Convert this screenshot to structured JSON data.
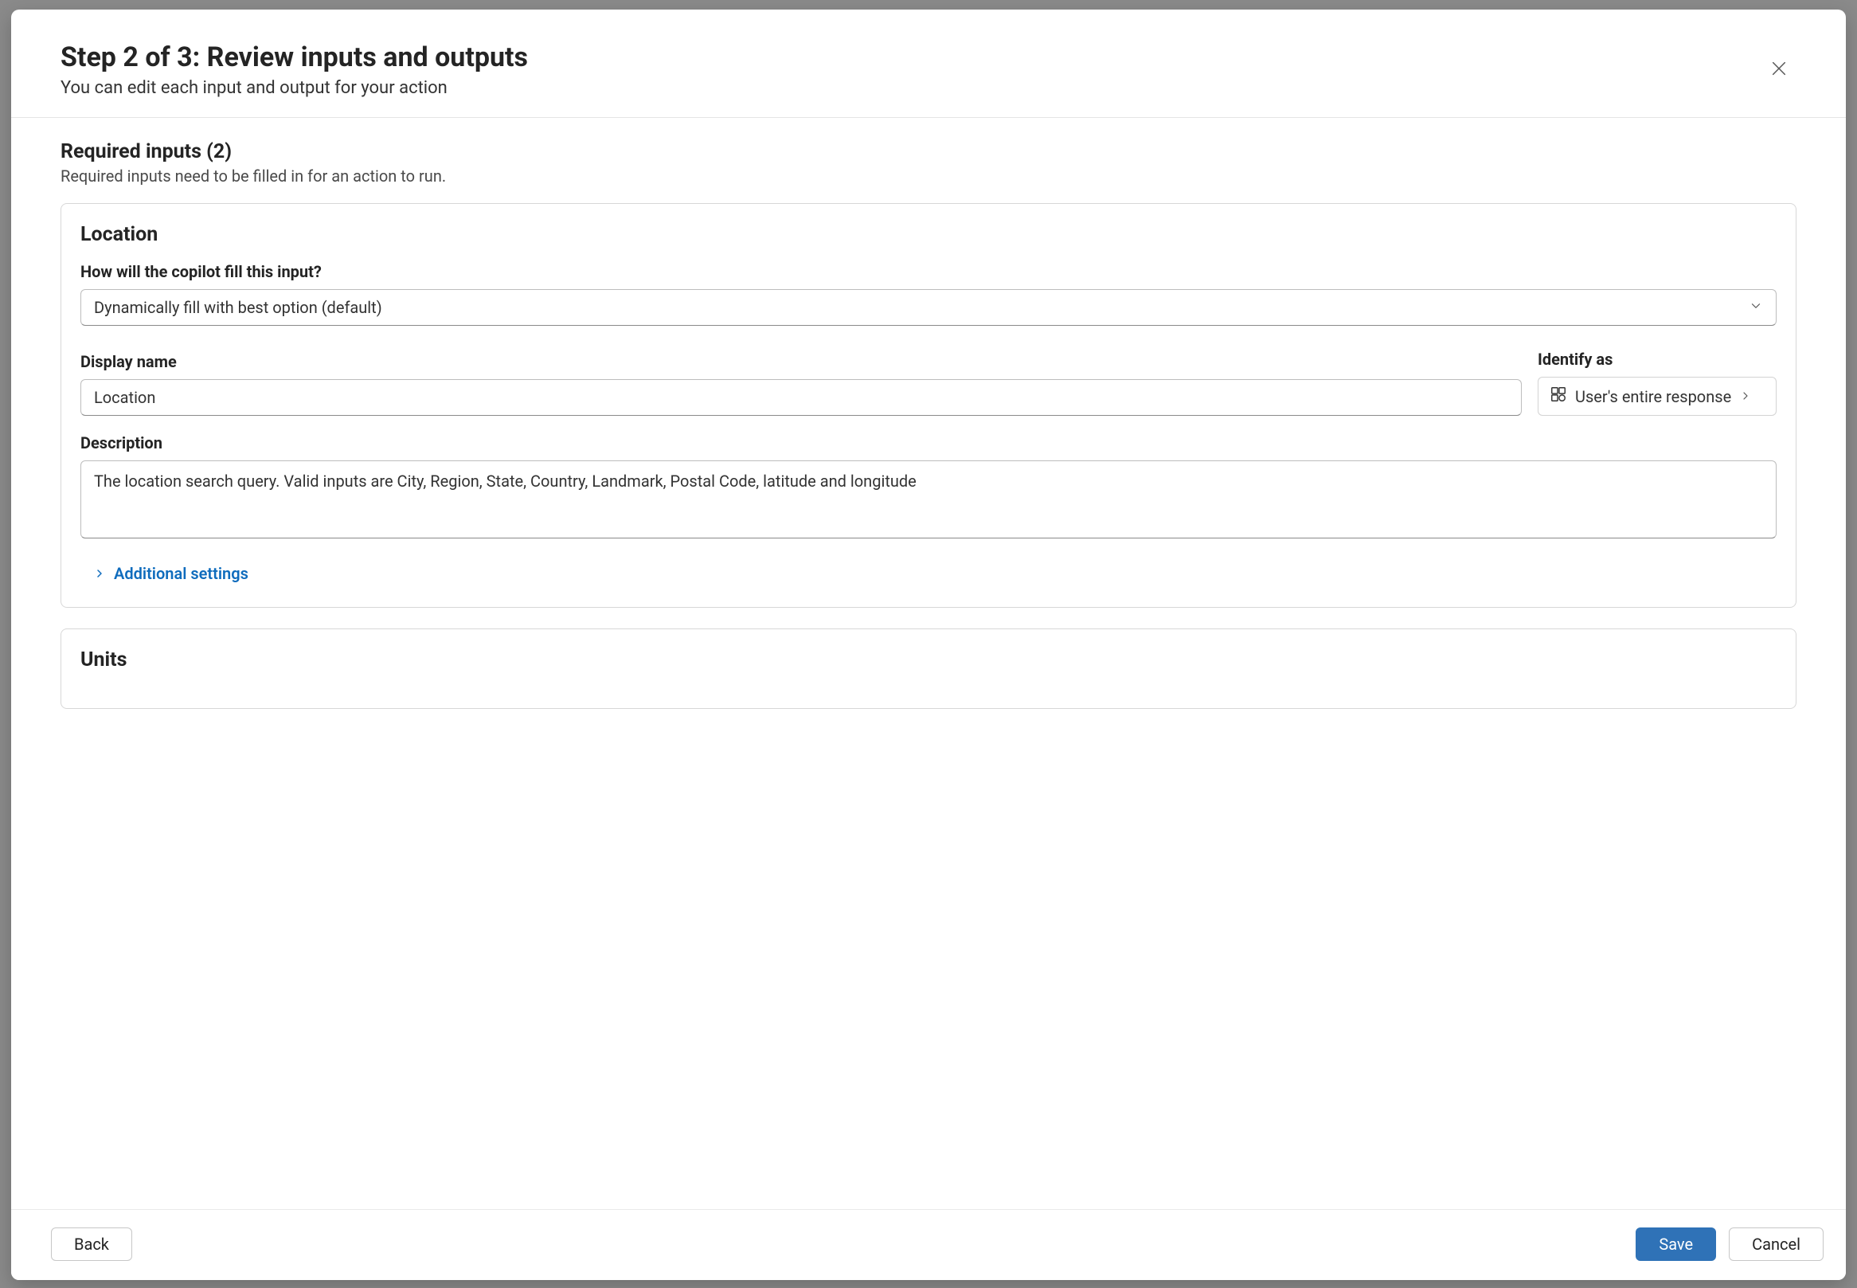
{
  "header": {
    "title": "Step 2 of 3: Review inputs and outputs",
    "subtitle": "You can edit each input and output for your action"
  },
  "required": {
    "heading": "Required inputs (2)",
    "sub": "Required inputs need to be filled in for an action to run."
  },
  "inputs": [
    {
      "title": "Location",
      "fill_label": "How will the copilot fill this input?",
      "fill_value": "Dynamically fill with best option (default)",
      "display_name_label": "Display name",
      "display_name_value": "Location",
      "identify_label": "Identify as",
      "identify_value": "User's entire response",
      "description_label": "Description",
      "description_value": "The location search query. Valid inputs are City, Region, State, Country, Landmark, Postal Code, latitude and longitude",
      "additional_settings": "Additional settings"
    },
    {
      "title": "Units"
    }
  ],
  "footer": {
    "back": "Back",
    "save": "Save",
    "cancel": "Cancel"
  }
}
